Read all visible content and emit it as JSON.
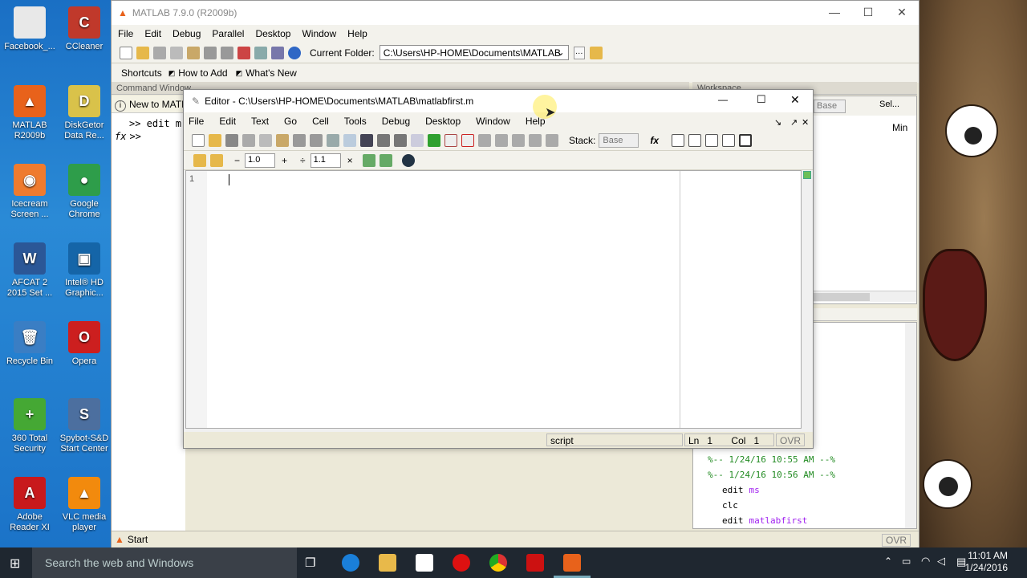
{
  "desktop_icons": [
    {
      "label": "Facebook_...",
      "color": "#e8e8e8",
      "glyph": ""
    },
    {
      "label": "CCleaner",
      "color": "#c0392b",
      "glyph": "C"
    },
    {
      "label": "MATLAB R2009b",
      "color": "#e8621b",
      "glyph": "▲"
    },
    {
      "label": "DiskGetor Data Re...",
      "color": "#d9c24a",
      "glyph": "D"
    },
    {
      "label": "Icecream Screen ...",
      "color": "#ef7b2e",
      "glyph": "◉"
    },
    {
      "label": "Google Chrome",
      "color": "#2e9d4a",
      "glyph": "●"
    },
    {
      "label": "AFCAT 2 2015 Set ...",
      "color": "#2b5797",
      "glyph": "W"
    },
    {
      "label": "Intel® HD Graphic...",
      "color": "#1565a8",
      "glyph": "▣"
    },
    {
      "label": "Recycle Bin",
      "color": "#3a7ec4",
      "glyph": "🗑"
    },
    {
      "label": "Opera",
      "color": "#cc1f1f",
      "glyph": "O"
    },
    {
      "label": "360 Total Security",
      "color": "#45a834",
      "glyph": "+"
    },
    {
      "label": "Spybot-S&D Start Center",
      "color": "#4c6f9f",
      "glyph": "S"
    },
    {
      "label": "Adobe Reader XI",
      "color": "#c8191c",
      "glyph": "A"
    },
    {
      "label": "VLC media player",
      "color": "#f28a0d",
      "glyph": "▲"
    }
  ],
  "matlab": {
    "title": "MATLAB 7.9.0 (R2009b)",
    "menu": [
      "File",
      "Edit",
      "Debug",
      "Parallel",
      "Desktop",
      "Window",
      "Help"
    ],
    "current_folder_label": "Current Folder:",
    "current_folder_value": "C:\\Users\\HP-HOME\\Documents\\MATLAB",
    "shortcuts": [
      "Shortcuts",
      "How to Add",
      "What's New"
    ],
    "command_window_title": "Command Window",
    "new_to_matlab": "New to MATLAB",
    "cmd_lines": [
      ">> edit m",
      ">>"
    ],
    "workspace_title": "Workspace",
    "workspace_stack": "Base",
    "workspace_select": "Sel...",
    "workspace_col_min": "Min",
    "history": [
      {
        "text": "%-- 1/24/16 10:55 AM --%",
        "type": "comment"
      },
      {
        "text": "%-- 1/24/16 10:56 AM --%",
        "type": "comment"
      },
      {
        "cmd": "edit",
        "arg": "ms",
        "type": "cmd"
      },
      {
        "cmd": "clc",
        "arg": "",
        "type": "cmd"
      },
      {
        "cmd": "edit",
        "arg": "matlabfirst",
        "type": "cmd"
      }
    ],
    "start_label": "Start",
    "ovr": "OVR"
  },
  "editor": {
    "title": "Editor - C:\\Users\\HP-HOME\\Documents\\MATLAB\\matlabfirst.m",
    "menu": [
      "File",
      "Edit",
      "Text",
      "Go",
      "Cell",
      "Tools",
      "Debug",
      "Desktop",
      "Window",
      "Help"
    ],
    "stack_label": "Stack:",
    "stack_value": "Base",
    "cell_minus": "−",
    "cell_value1": "1.0",
    "cell_plus": "+",
    "cell_div": "÷",
    "cell_value2": "1.1",
    "cell_times": "×",
    "line_number": "1",
    "status_type": "script",
    "status_ln_label": "Ln",
    "status_ln": "1",
    "status_col_label": "Col",
    "status_col": "1",
    "status_ovr": "OVR"
  },
  "taskbar": {
    "search_placeholder": "Search the web and Windows",
    "time": "11:01 AM",
    "date": "1/24/2016"
  }
}
